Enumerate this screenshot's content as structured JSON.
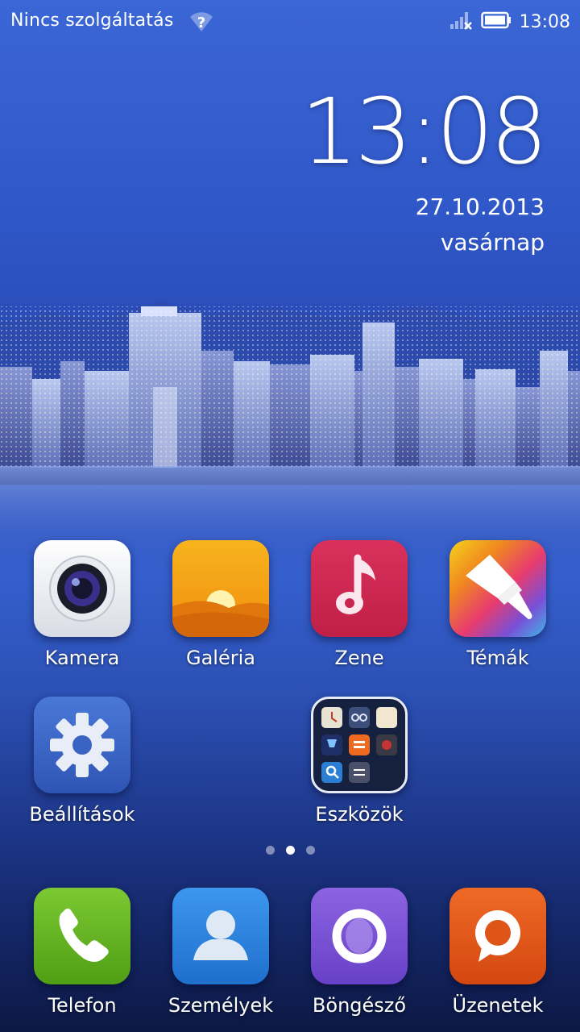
{
  "status_bar": {
    "carrier": "Nincs szolgáltatás",
    "time": "13:08",
    "icons": [
      "wifi-unknown-icon",
      "signal-no-sim-icon",
      "battery-icon"
    ]
  },
  "clock_widget": {
    "time": "13:08",
    "date": "27.10.2013",
    "weekday": "vasárnap"
  },
  "apps": [
    {
      "label": "Kamera",
      "icon": "camera-icon"
    },
    {
      "label": "Galéria",
      "icon": "gallery-icon"
    },
    {
      "label": "Zene",
      "icon": "music-icon"
    },
    {
      "label": "Témák",
      "icon": "themes-brush-icon"
    },
    {
      "label": "Beállítások",
      "icon": "settings-gear-icon"
    },
    {
      "label": "Eszközök",
      "icon": "tools-folder-icon"
    }
  ],
  "page_indicator": {
    "pages": 3,
    "current": 2
  },
  "dock": [
    {
      "label": "Telefon",
      "icon": "phone-icon"
    },
    {
      "label": "Személyek",
      "icon": "contacts-icon"
    },
    {
      "label": "Böngésző",
      "icon": "browser-icon"
    },
    {
      "label": "Üzenetek",
      "icon": "messages-icon"
    }
  ],
  "colors": {
    "phone": "#5fb21c",
    "contacts": "#2f86e0",
    "browser": "#7b52d8",
    "messages": "#e2561c",
    "music": "#cf2650",
    "settings": "#3d68c8"
  }
}
